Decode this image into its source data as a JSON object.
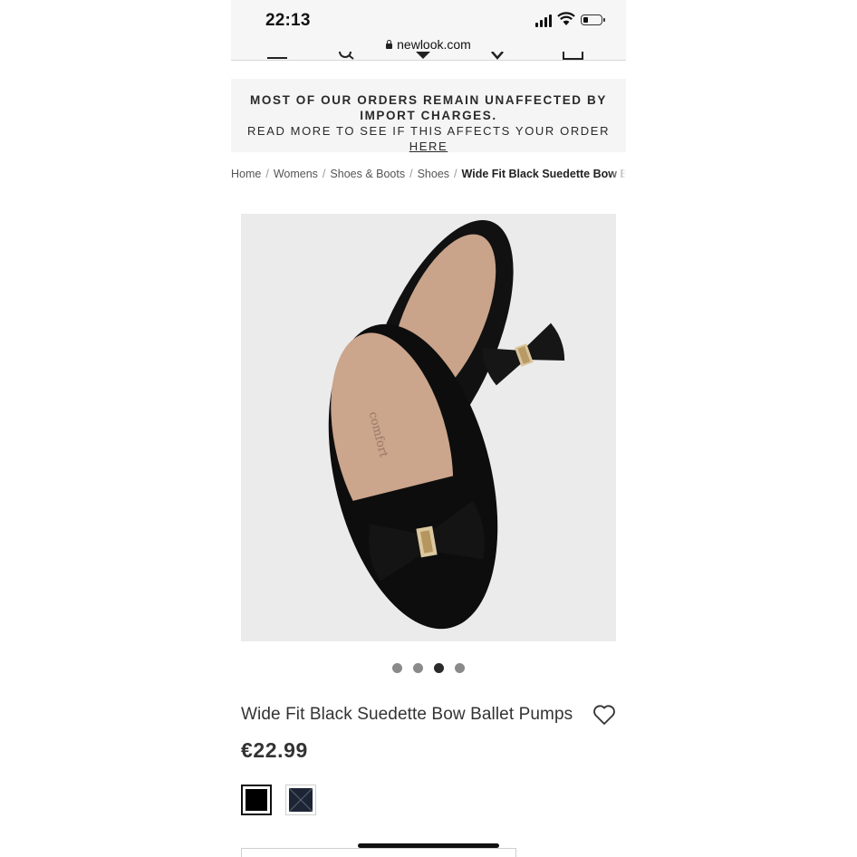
{
  "status_bar": {
    "time": "22:13",
    "battery_level": 0.2
  },
  "browser": {
    "url": "newlook.com",
    "lock_icon": "lock-icon"
  },
  "banner": {
    "headline": "MOST OF OUR ORDERS REMAIN UNAFFECTED BY IMPORT CHARGES.",
    "subline": "READ MORE TO SEE IF THIS AFFECTS YOUR ORDER",
    "link": "HERE"
  },
  "breadcrumb": {
    "items": [
      "Home",
      "Womens",
      "Shoes & Boots",
      "Shoes"
    ],
    "separator": "/",
    "current": "Wide Fit Black Suedette Bow Ballet Pumps"
  },
  "gallery": {
    "image_count": 4,
    "active_index": 2
  },
  "product": {
    "name": "Wide Fit Black Suedette Bow Ballet Pumps",
    "price": "€22.99",
    "wishlist_icon": "heart-icon"
  },
  "swatches": [
    {
      "name": "black",
      "color": "#000000",
      "selected": true
    },
    {
      "name": "navy",
      "color": "#1d2535",
      "selected": false
    }
  ],
  "colors": {
    "banner_bg": "#f5f5f5",
    "image_bg": "#ebebeb",
    "text": "#333333"
  }
}
